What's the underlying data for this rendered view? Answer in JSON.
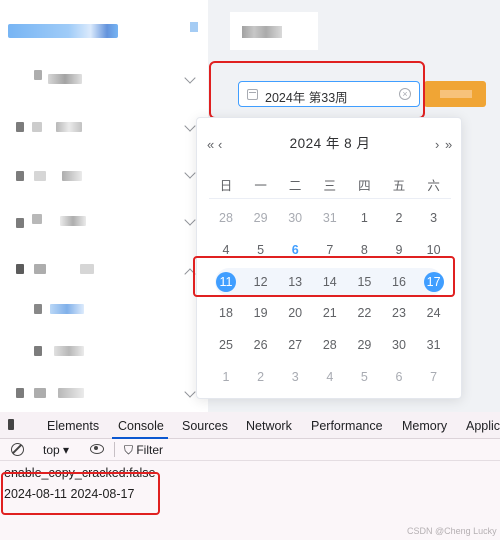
{
  "date_input": {
    "value": "2024年 第33周"
  },
  "picker": {
    "prev_year": "«",
    "prev_month": "‹",
    "next_month": "›",
    "next_year": "»",
    "title": "2024 年  8 月",
    "weekdays": [
      "日",
      "一",
      "二",
      "三",
      "四",
      "五",
      "六"
    ],
    "weeks": [
      [
        "28",
        "29",
        "30",
        "31",
        "1",
        "2",
        "3"
      ],
      [
        "4",
        "5",
        "6",
        "7",
        "8",
        "9",
        "10"
      ],
      [
        "11",
        "12",
        "13",
        "14",
        "15",
        "16",
        "17"
      ],
      [
        "18",
        "19",
        "20",
        "21",
        "22",
        "23",
        "24"
      ],
      [
        "25",
        "26",
        "27",
        "28",
        "29",
        "30",
        "31"
      ],
      [
        "1",
        "2",
        "3",
        "4",
        "5",
        "6",
        "7"
      ]
    ]
  },
  "devtools": {
    "tabs": [
      "Elements",
      "Console",
      "Sources",
      "Network",
      "Performance",
      "Memory",
      "Applic"
    ],
    "active_tab": "Console",
    "context": "top ▾",
    "filter": "Filter",
    "logs": [
      "enable_copy_cracked:false",
      "2024-08-11 2024-08-17"
    ]
  },
  "watermark": "CSDN @Cheng Lucky",
  "colors": {
    "accent": "#409eff",
    "highlight_border": "#e02020",
    "button_orange": "#f0a535"
  }
}
